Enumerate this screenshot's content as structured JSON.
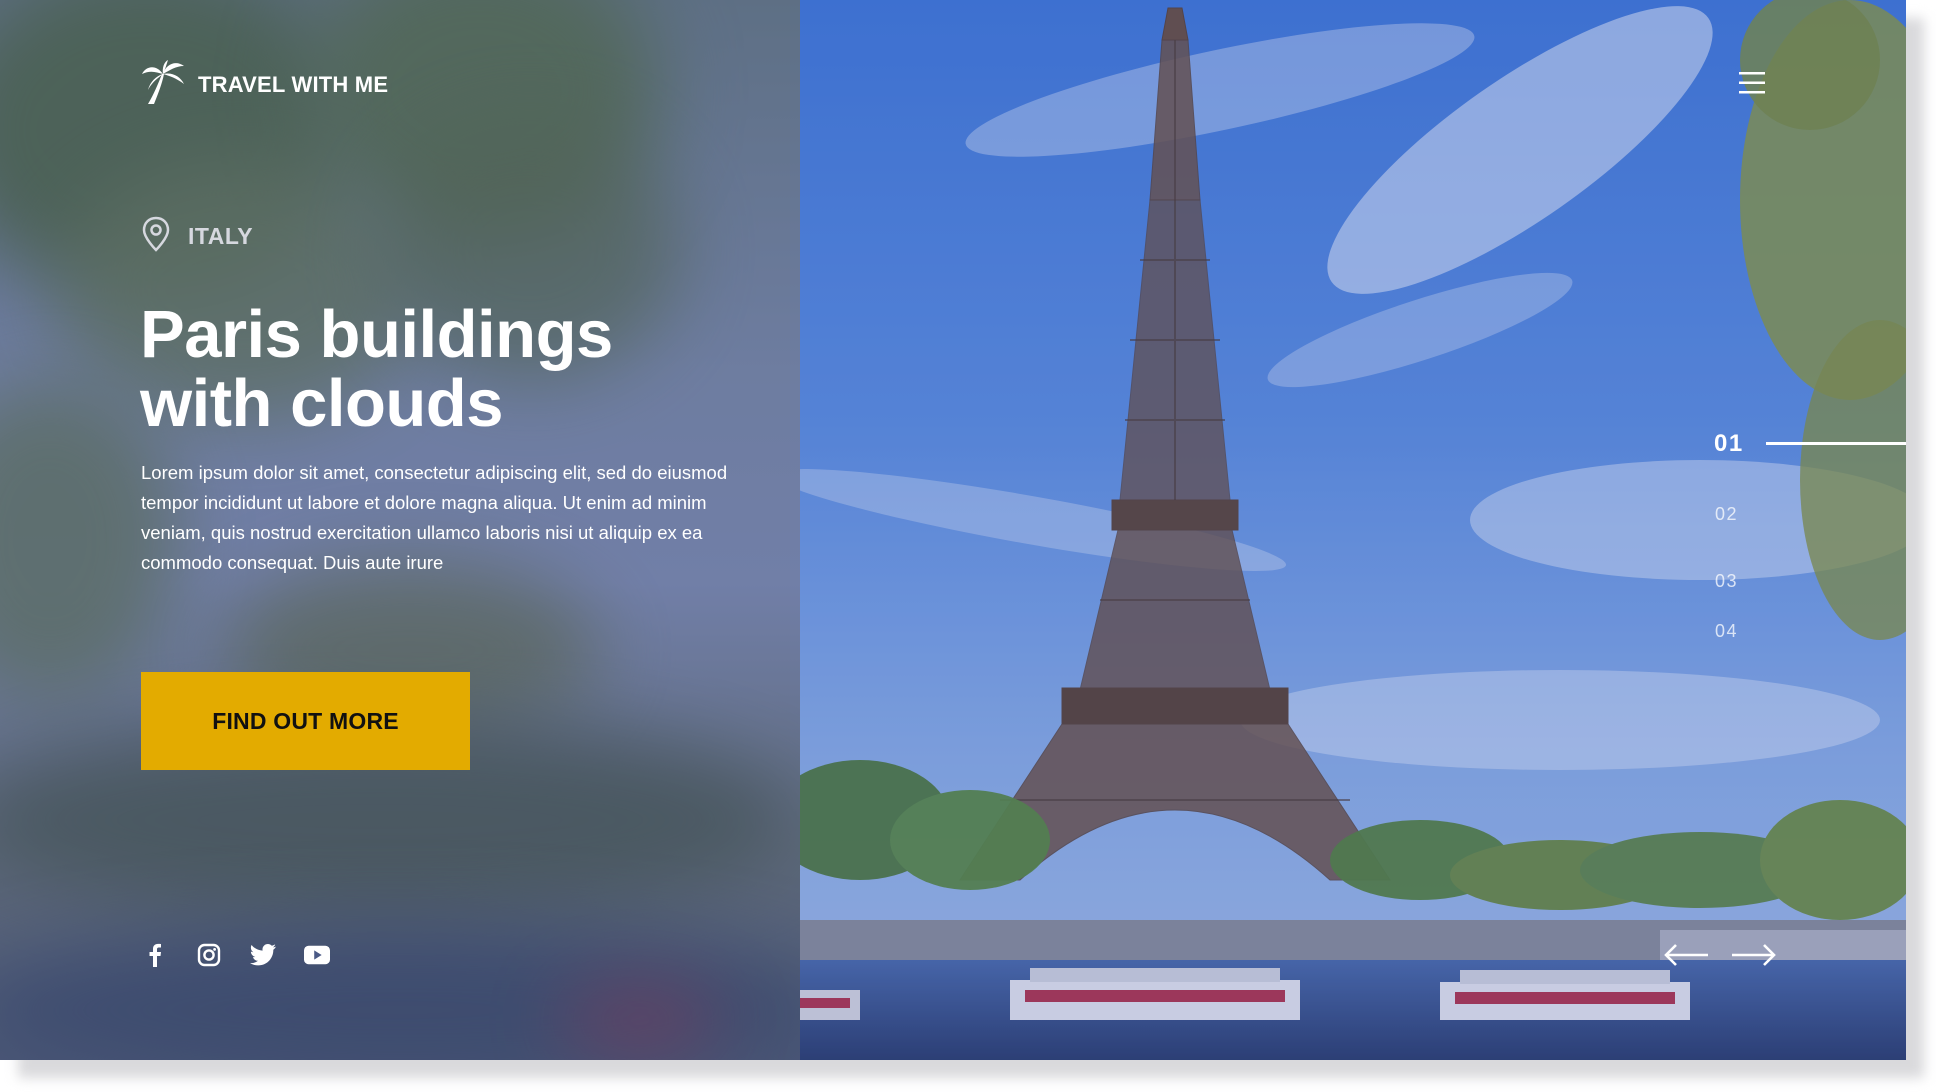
{
  "brand": {
    "name": "TRAVEL WITH ME",
    "logo_icon": "palm-tree-icon"
  },
  "location": {
    "icon": "map-pin-icon",
    "label": "ITALY"
  },
  "hero": {
    "title_line1": "Paris buildings",
    "title_line2": "with clouds",
    "description": "Lorem ipsum dolor sit amet, consectetur adipiscing elit, sed do eiusmod tempor incididunt ut labore et dolore magna aliqua. Ut enim ad minim veniam, quis nostrud exercitation ullamco laboris nisi ut aliquip ex ea commodo consequat. Duis aute irure",
    "cta_label": "FIND OUT MORE"
  },
  "social": [
    "facebook-icon",
    "instagram-icon",
    "twitter-icon",
    "youtube-icon"
  ],
  "slider": {
    "items": [
      "01",
      "02",
      "03",
      "04"
    ],
    "active": "01"
  },
  "colors": {
    "accent": "#e3ab00",
    "text": "#ffffff",
    "overlay": "#3e5296"
  }
}
